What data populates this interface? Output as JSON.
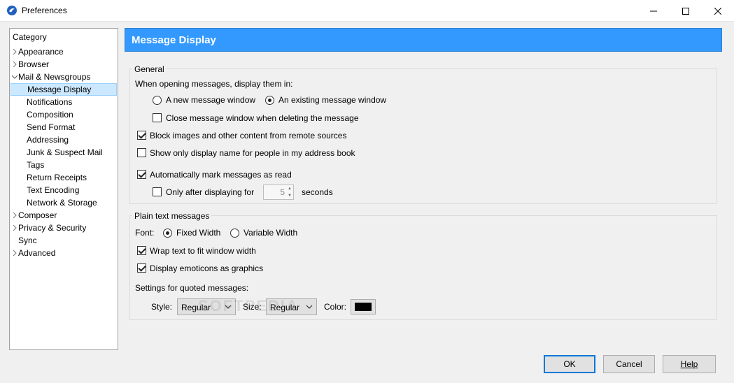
{
  "window": {
    "title": "Preferences",
    "app_icon": "seamonkey-icon",
    "controls": [
      "minimize-icon",
      "maximize-icon",
      "close-icon"
    ]
  },
  "category": {
    "heading": "Category",
    "items": [
      {
        "label": "Appearance",
        "level": 0,
        "expander": "collapsed"
      },
      {
        "label": "Browser",
        "level": 0,
        "expander": "collapsed"
      },
      {
        "label": "Mail & Newsgroups",
        "level": 0,
        "expander": "expanded"
      },
      {
        "label": "Message Display",
        "level": 1,
        "selected": true
      },
      {
        "label": "Notifications",
        "level": 1
      },
      {
        "label": "Composition",
        "level": 1
      },
      {
        "label": "Send Format",
        "level": 1
      },
      {
        "label": "Addressing",
        "level": 1
      },
      {
        "label": "Junk & Suspect Mail",
        "level": 1
      },
      {
        "label": "Tags",
        "level": 1
      },
      {
        "label": "Return Receipts",
        "level": 1
      },
      {
        "label": "Text Encoding",
        "level": 1
      },
      {
        "label": "Network & Storage",
        "level": 1
      },
      {
        "label": "Composer",
        "level": 0,
        "expander": "collapsed"
      },
      {
        "label": "Privacy & Security",
        "level": 0,
        "expander": "collapsed"
      },
      {
        "label": "Sync",
        "level": 0
      },
      {
        "label": "Advanced",
        "level": 0,
        "expander": "collapsed"
      }
    ]
  },
  "header": {
    "title": "Message Display",
    "color": "#3399ff"
  },
  "general": {
    "legend": "General",
    "open_prompt": "When opening messages, display them in:",
    "radio_new": "A new message window",
    "radio_existing": "An existing message window",
    "radio_selected": "existing",
    "close_on_delete": "Close message window when deleting the message",
    "close_on_delete_checked": false,
    "block_images": "Block images and other content from remote sources",
    "block_images_checked": true,
    "show_display_name": "Show only display name for people in my address book",
    "show_display_name_checked": false,
    "auto_mark_read": "Automatically mark messages as read",
    "auto_mark_read_checked": true,
    "only_after": "Only after displaying for",
    "only_after_checked": false,
    "delay_value": "5",
    "seconds_label": "seconds"
  },
  "plain_text": {
    "legend": "Plain text messages",
    "font_label": "Font:",
    "fixed_width": "Fixed Width",
    "variable_width": "Variable Width",
    "font_selected": "fixed",
    "wrap_text": "Wrap text to fit window width",
    "wrap_text_checked": true,
    "emoticons": "Display emoticons as graphics",
    "emoticons_checked": true,
    "quoted_heading": "Settings for quoted messages:",
    "style_label": "Style:",
    "style_value": "Regular",
    "size_label": "Size:",
    "size_value": "Regular",
    "color_label": "Color:",
    "quote_color": "#000000"
  },
  "buttons": {
    "ok": "OK",
    "cancel": "Cancel",
    "help": "Help"
  },
  "watermark": "SOFTPEDIA"
}
